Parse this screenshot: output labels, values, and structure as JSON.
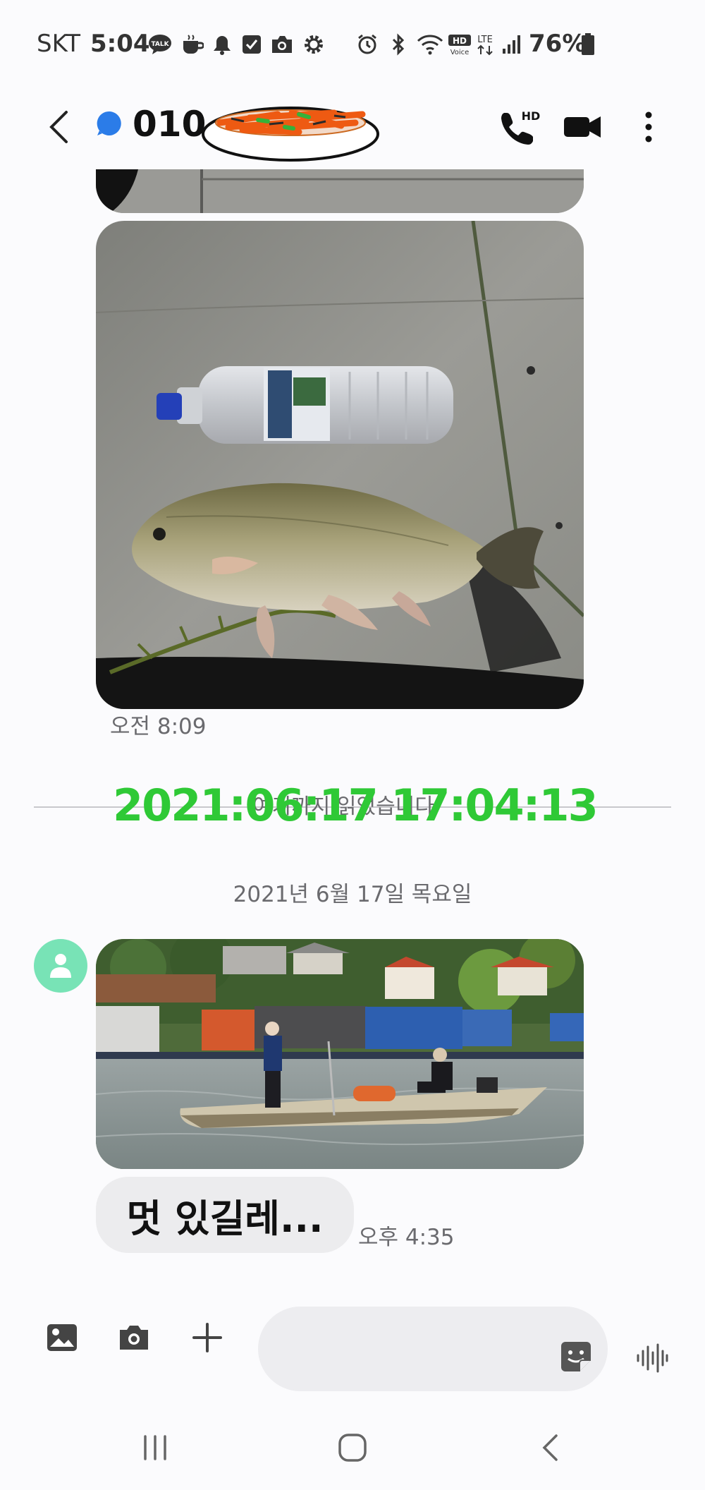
{
  "status_bar": {
    "carrier": "SKT",
    "time": "5:04",
    "battery": "76%",
    "network": "LTE",
    "left_icons": [
      "kakaotalk-icon",
      "coffee-icon",
      "bell-icon",
      "check-icon",
      "camera-icon",
      "settings-icon"
    ],
    "right_icons": [
      "alarm-icon",
      "bluetooth-icon",
      "wifi-icon",
      "hd-voice-icon",
      "lte-icon",
      "signal-icon",
      "battery-icon"
    ]
  },
  "header": {
    "contact_prefix": "010-",
    "icons": [
      "back-icon",
      "unread-dot-icon",
      "hd-call-icon",
      "video-call-icon",
      "more-icon"
    ]
  },
  "messages": {
    "sent_time": "오전 8:09",
    "watermark": "2021:06:17 17:04:13",
    "divider_text": "여기까지 읽었습니다",
    "date_label": "2021년 6월 17일 목요일",
    "bubble_text": "멋 있길레...",
    "received_time": "오후 4:35"
  },
  "composer": {
    "icons": [
      "gallery-icon",
      "camera-icon",
      "add-icon",
      "sticker-icon",
      "voice-icon"
    ]
  },
  "nav_bar": {
    "icons": [
      "recent-apps-icon",
      "home-icon",
      "back-icon"
    ]
  },
  "colors": {
    "background": "#fbfbfd",
    "unread_dot": "#2b7ce8",
    "watermark_green": "#2fc936",
    "avatar": "#78e3b6"
  }
}
